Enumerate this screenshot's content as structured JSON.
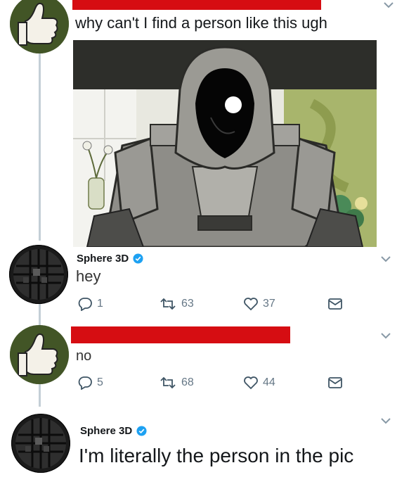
{
  "tweets": [
    {
      "author": "",
      "text": "why can't I find a person like this ugh",
      "has_media": true,
      "name_redacted": true
    },
    {
      "author": "Sphere 3D",
      "verified": true,
      "text": "hey",
      "stats": {
        "replies": "1",
        "retweets": "63",
        "likes": "37"
      }
    },
    {
      "author": "",
      "name_redacted": true,
      "text": "no",
      "stats": {
        "replies": "5",
        "retweets": "68",
        "likes": "44"
      }
    },
    {
      "author": "Sphere 3D",
      "verified": true,
      "text": "I'm literally the person in the pic"
    }
  ],
  "icons": {
    "reply": "reply-icon",
    "retweet": "retweet-icon",
    "like": "heart-icon",
    "dm": "mail-icon",
    "menu": "chevron-down-icon",
    "verified": "verified-badge-icon"
  },
  "colors": {
    "verified": "#1da1f2",
    "redaction": "#d60d12",
    "icon_gray": "#657786",
    "thread_line": "#c4cfd6"
  }
}
